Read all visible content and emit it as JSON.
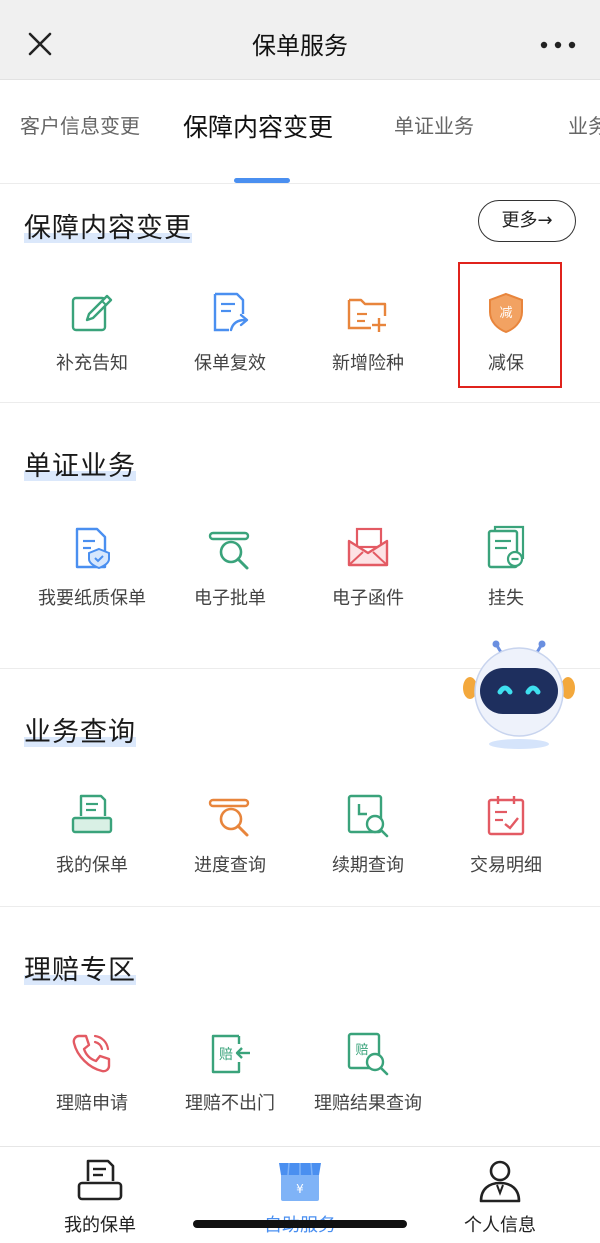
{
  "header": {
    "title": "保单服务"
  },
  "tabs": [
    {
      "label": "客户信息变更"
    },
    {
      "label": "保障内容变更"
    },
    {
      "label": "单证业务"
    },
    {
      "label": "业务"
    }
  ],
  "sections": {
    "coverage": {
      "title": "保障内容变更",
      "more_label": "更多→",
      "items": [
        {
          "label": "补充告知",
          "icon": "edit-icon"
        },
        {
          "label": "保单复效",
          "icon": "document-share-icon"
        },
        {
          "label": "新增险种",
          "icon": "folder-add-icon"
        },
        {
          "label": "减保",
          "icon": "shield-reduce-icon",
          "badge": "减"
        }
      ]
    },
    "documents": {
      "title": "单证业务",
      "items": [
        {
          "label": "我要纸质保单",
          "icon": "paper-policy-icon"
        },
        {
          "label": "电子批单",
          "icon": "search-document-icon"
        },
        {
          "label": "电子函件",
          "icon": "mail-icon"
        },
        {
          "label": "挂失",
          "icon": "report-loss-icon"
        }
      ]
    },
    "query": {
      "title": "业务查询",
      "items": [
        {
          "label": "我的保单",
          "icon": "printer-policy-icon"
        },
        {
          "label": "进度查询",
          "icon": "progress-search-icon"
        },
        {
          "label": "续期查询",
          "icon": "renewal-search-icon"
        },
        {
          "label": "交易明细",
          "icon": "calendar-check-icon"
        }
      ]
    },
    "claims": {
      "title": "理赔专区",
      "items": [
        {
          "label": "理赔申请",
          "icon": "phone-icon"
        },
        {
          "label": "理赔不出门",
          "icon": "claim-arrow-icon",
          "badge": "赔"
        },
        {
          "label": "理赔结果查询",
          "icon": "claim-search-icon",
          "badge": "赔"
        }
      ]
    }
  },
  "bottom_nav": [
    {
      "label": "我的保单",
      "icon": "printer-icon"
    },
    {
      "label": "自助服务",
      "icon": "store-icon",
      "badge": "¥"
    },
    {
      "label": "个人信息",
      "icon": "person-icon"
    }
  ],
  "colors": {
    "accent_blue": "#4a8ff0",
    "green": "#3aa37b",
    "orange": "#e8853c",
    "red_pink": "#e35a63",
    "highlight_red": "#e0231c"
  }
}
